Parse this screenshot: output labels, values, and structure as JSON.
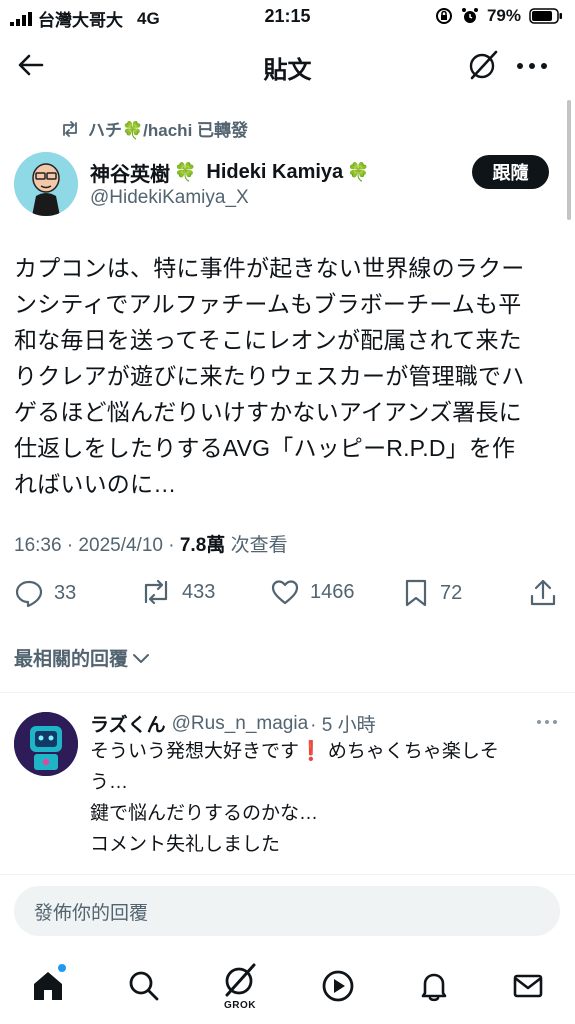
{
  "status_bar": {
    "carrier": "台灣大哥大",
    "network": "4G",
    "time": "21:15",
    "battery": "79%"
  },
  "header": {
    "title": "貼文",
    "back_icon": "arrow-left-icon",
    "grok_icon": "grok-icon",
    "more_icon": "more-horizontal-icon"
  },
  "retweet": {
    "text": "ハチ🍀/hachi 已轉發"
  },
  "author": {
    "name": "神谷英樹",
    "name_suffix": "Hideki Kamiya",
    "handle": "@HidekiKamiya_X",
    "follow_label": "跟隨"
  },
  "tweet": {
    "text_lines": [
      "カプコンは、特に事件が起きない世界線のラクー",
      "ンシティでアルファチームもブラボーチームも平",
      "和な毎日を送ってそこにレオンが配属されて来た",
      "りクレアが遊びに来たりウェスカーが管理職でハ",
      "ゲるほど悩んだりいけすかないアイアンズ署長に",
      "仕返しをしたりするAVG「ハッピーR.P.D」を作",
      "ればいいのに…"
    ],
    "time": "16:36 · 2025/4/10 ·",
    "views": "7.8萬",
    "views_label": "次查看"
  },
  "actions": {
    "replies": "33",
    "reposts": "433",
    "likes": "1466",
    "bookmarks": "72"
  },
  "sort": {
    "label": "最相關的回覆"
  },
  "reply": {
    "name": "ラズくん",
    "handle": "@Rus_n_magia",
    "time": "· 5 小時",
    "lines": [
      "そういう発想大好きです❗ めちゃくちゃ楽しそ",
      "う…",
      "鍵で悩んだりするのかな…",
      "コメント失礼しました"
    ]
  },
  "compose": {
    "placeholder": "發佈你的回覆"
  },
  "tabbar": {
    "grok_label": "GROK"
  },
  "colors": {
    "text": "#0f1419",
    "secondary": "#536471",
    "accent": "#1d9bf0",
    "clover": "#3aa84b"
  }
}
